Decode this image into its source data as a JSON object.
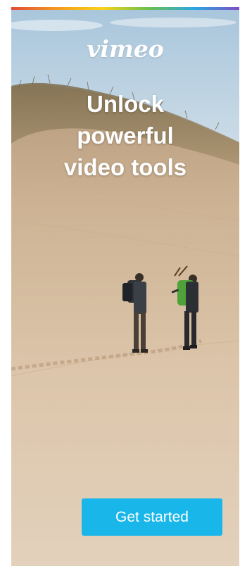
{
  "ad": {
    "logo_text": "vimeo",
    "headline": [
      "Unlock",
      "powerful",
      "video tools"
    ],
    "cta_label": "Get started"
  },
  "colors": {
    "brand_accent": "#19b6ea",
    "sky": "#b9d3e6",
    "sand": "#d8bfa3",
    "dune_grass": "#8a7a58",
    "rainbow": [
      "#e34a3a",
      "#f39a1e",
      "#f7d31b",
      "#6cc04a",
      "#2aa8e0",
      "#7d4ec4"
    ]
  }
}
